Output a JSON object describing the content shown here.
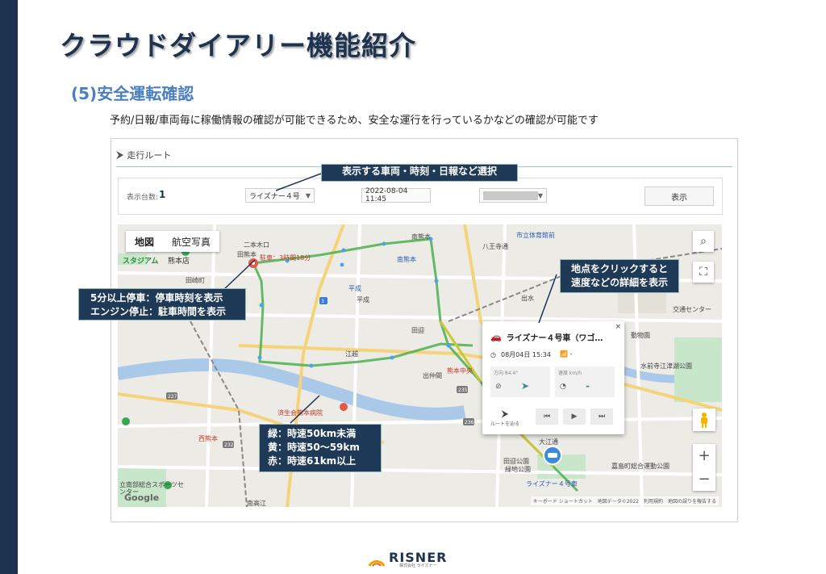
{
  "page": {
    "title": "クラウドダイアリー機能紹介",
    "subtitle": "(5)安全運転確認",
    "description": "予約/日報/車両毎に稼働情報の確認が可能できるため、安全な運行を行っているかなどの確認が可能です"
  },
  "panel": {
    "header": "走行ルート",
    "filters": {
      "count_label": "表示台数:",
      "count_value": "1",
      "vehicle_select": "ライズナー４号",
      "datetime": "2022-08-04 11:45",
      "show_button": "表示"
    }
  },
  "map": {
    "type_tabs": [
      "地図",
      "航空写真"
    ],
    "labels": {
      "stadium": "スタジアム",
      "kumamoto_store": "熊本店",
      "tasaki": "田崎町",
      "nihongi": "二本木口",
      "kumamoto_ta": "田熊本",
      "parking": "駐車：3時間18分",
      "minami_kumamoto": "南熊本",
      "heisei_station": "平成",
      "heisei": "平成",
      "kitakumamoto_station": "南熊本",
      "hachioji": "八王寺通",
      "shiritsu": "市立体育館前",
      "koe": "江越",
      "tayo": "田迎",
      "demachi": "出仲間",
      "kumamoto_naka": "熊本中央",
      "demizu": "出水",
      "hospital": "済生会熊本病院",
      "nishi_kumamoto": "西熊本",
      "minami_park": "立南部総合スポーツセンター",
      "daishin": "大江通",
      "park": "田迎公園",
      "ezu": "水前寺江津湖公園",
      "kashima": "嘉島町総合運動公園",
      "animal": "動物園",
      "nanbu": "南高江",
      "route_car": "ライズナー４号車",
      "cross": "交通センター",
      "ryokuchi": "緑地公園"
    },
    "google": "Google",
    "attribution": "キーボード ショートカット　地図データ©2022　利用規約　地図の誤りを報告する"
  },
  "popup": {
    "title": "ライズナー４号車（ワゴ…",
    "close": "×",
    "date": "08月04日 15:34",
    "signal": "-",
    "direction_label": "方向 84.4°",
    "speed_label": "速度 km/h",
    "speed_value": "-",
    "route_label": "ルートを辿る"
  },
  "callouts": {
    "select": "表示する車両・時刻・日報など選択",
    "click_line1": "地点をクリックすると",
    "click_line2": "速度などの詳細を表示",
    "stop_line1": "5分以上停車：停車時刻を表示",
    "stop_line2": "エンジン停止：駐車時間を表示",
    "legend_line1": "緑：時速50km未満",
    "legend_line2": "黄：時速50～59km",
    "legend_line3": "赤：時速61km以上"
  },
  "footer": {
    "brand": "RISNER",
    "company": "株式会社 ライズナー"
  },
  "colors": {
    "navy": "#1e3350",
    "route_green": "#4caf50",
    "route_yellow": "#c9c83a",
    "accent_blue": "#4a7fc1"
  }
}
